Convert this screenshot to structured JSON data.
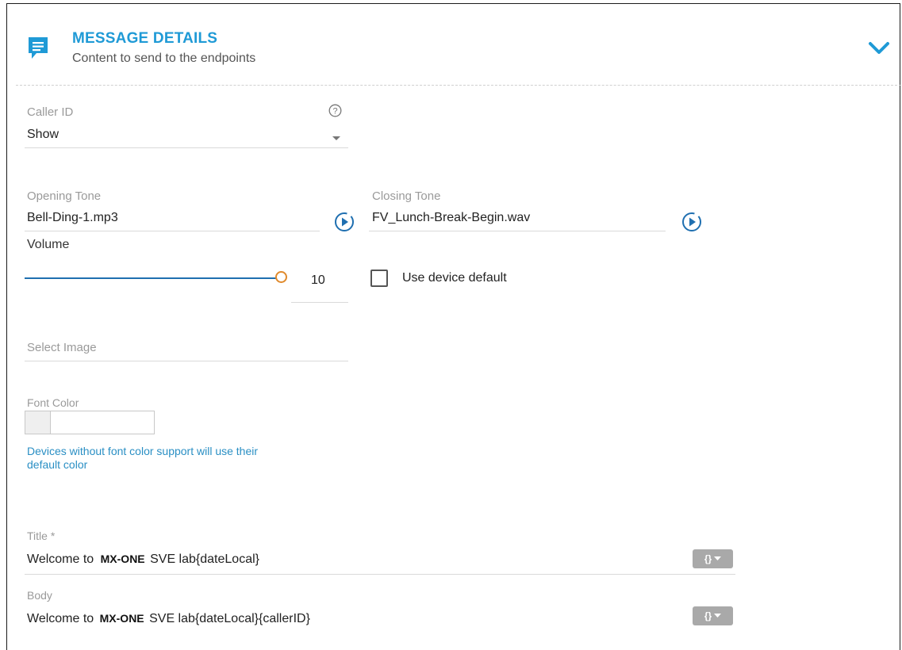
{
  "header": {
    "title": "MESSAGE DETAILS",
    "subtitle": "Content to send to the endpoints"
  },
  "caller_id": {
    "label": "Caller ID",
    "value": "Show"
  },
  "opening_tone": {
    "label": "Opening Tone",
    "value": "Bell-Ding-1.mp3"
  },
  "closing_tone": {
    "label": "Closing Tone",
    "value": "FV_Lunch-Break-Begin.wav"
  },
  "volume": {
    "label": "Volume",
    "value": "10",
    "level": 1.0,
    "use_default_label": "Use device default",
    "use_default_checked": false
  },
  "image": {
    "placeholder": "Select Image"
  },
  "font_color": {
    "label": "Font Color",
    "hint_line1": "Devices without font color support will use their",
    "hint_line2": "default color"
  },
  "title_field": {
    "label": "Title *",
    "prefix": "Welcome to",
    "brand": "MX-ONE",
    "suffix": "SVE lab{dateLocal}",
    "token_button": "{}"
  },
  "body_field": {
    "label": "Body",
    "prefix": "Welcome to",
    "brand": "MX-ONE",
    "suffix": "SVE lab{dateLocal}{callerID}",
    "token_button": "{}"
  },
  "colors": {
    "accent": "#1f9ad6",
    "slider_thumb": "#e08a2c",
    "token_button": "#a9a9a9"
  },
  "icons": [
    "message-icon",
    "chevron-down-icon",
    "help-icon",
    "dropdown-caret-icon",
    "play-icon",
    "checkbox"
  ]
}
